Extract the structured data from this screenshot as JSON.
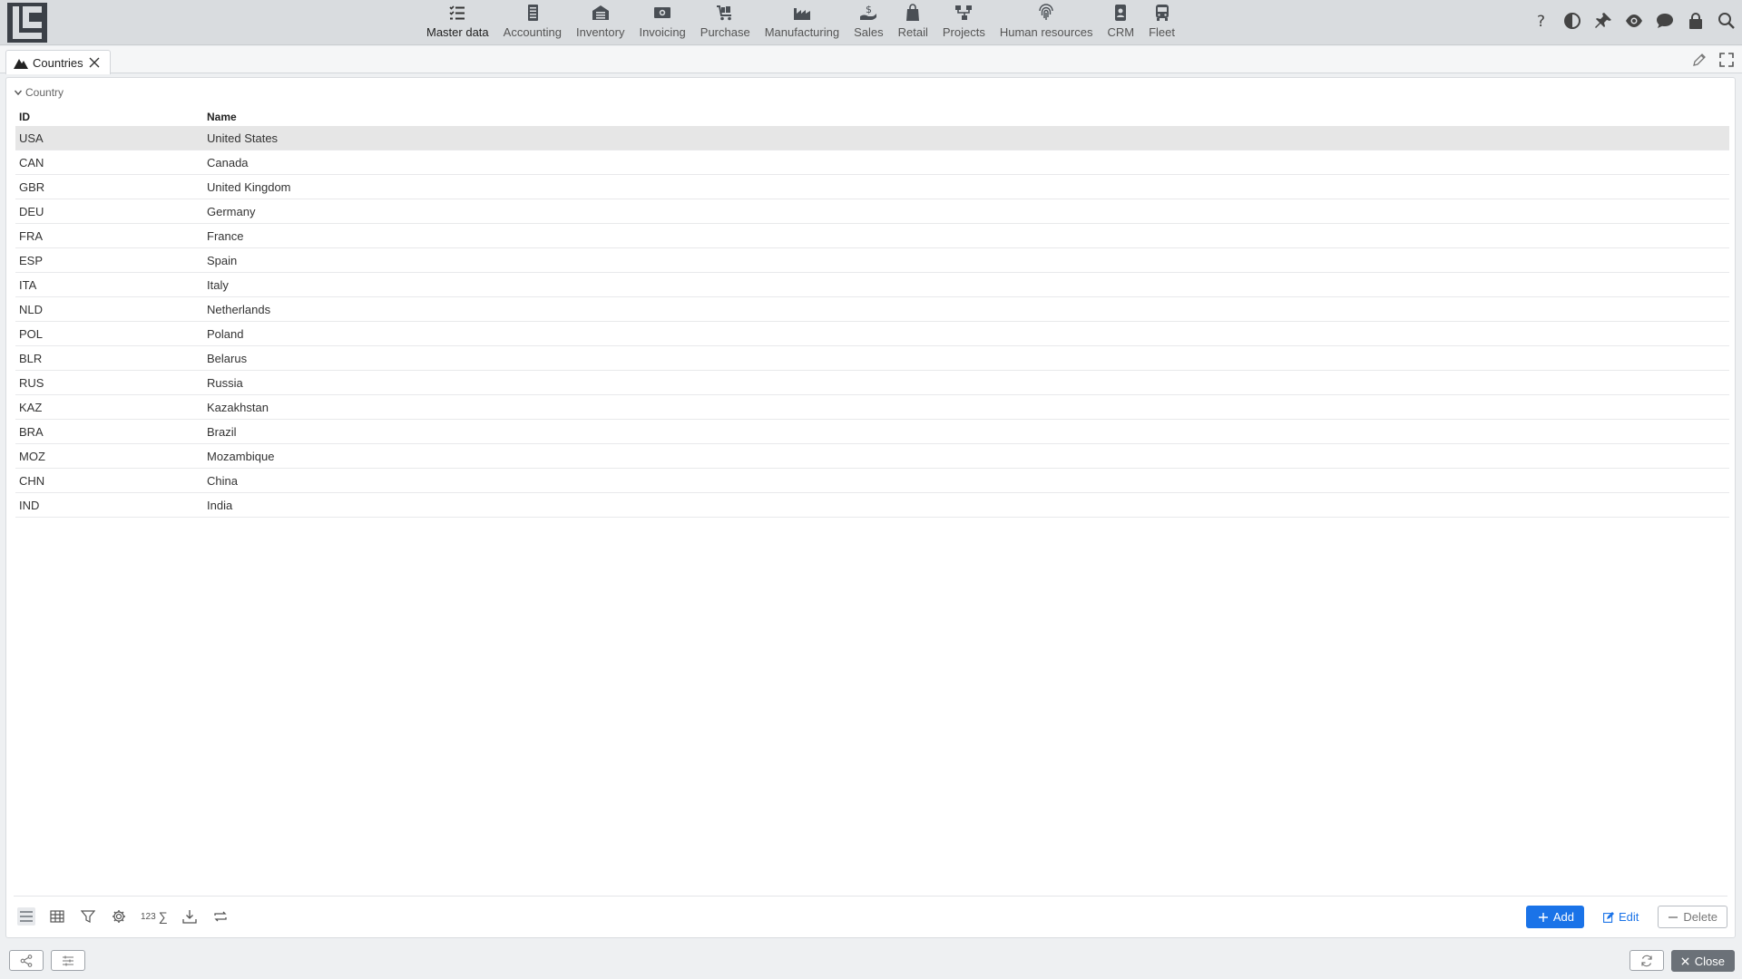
{
  "app": {
    "logo_icon": "app-logo",
    "nav": [
      {
        "label": "Master data",
        "icon": "checklist-icon",
        "active": true
      },
      {
        "label": "Accounting",
        "icon": "ledger-icon"
      },
      {
        "label": "Inventory",
        "icon": "warehouse-icon"
      },
      {
        "label": "Invoicing",
        "icon": "banknote-icon"
      },
      {
        "label": "Purchase",
        "icon": "cart-icon"
      },
      {
        "label": "Manufacturing",
        "icon": "factory-icon"
      },
      {
        "label": "Sales",
        "icon": "hand-dollar-icon"
      },
      {
        "label": "Retail",
        "icon": "shopping-bag-icon"
      },
      {
        "label": "Projects",
        "icon": "hierarchy-icon"
      },
      {
        "label": "Human resources",
        "icon": "fingerprint-icon"
      },
      {
        "label": "CRM",
        "icon": "contact-card-icon"
      },
      {
        "label": "Fleet",
        "icon": "bus-icon"
      }
    ],
    "top_tools": [
      "help-icon",
      "contrast-icon",
      "pin-icon",
      "eye-icon",
      "chat-icon",
      "lock-icon",
      "search-icon"
    ]
  },
  "tab": {
    "label": "Countries",
    "icon": "mountain-icon"
  },
  "panel": {
    "section_title": "Country",
    "columns": {
      "id": "ID",
      "name": "Name"
    },
    "rows": [
      {
        "id": "USA",
        "name": "United States",
        "selected": true
      },
      {
        "id": "CAN",
        "name": "Canada"
      },
      {
        "id": "GBR",
        "name": "United Kingdom"
      },
      {
        "id": "DEU",
        "name": "Germany"
      },
      {
        "id": "FRA",
        "name": "France"
      },
      {
        "id": "ESP",
        "name": "Spain"
      },
      {
        "id": "ITA",
        "name": "Italy"
      },
      {
        "id": "NLD",
        "name": "Netherlands"
      },
      {
        "id": "POL",
        "name": "Poland"
      },
      {
        "id": "BLR",
        "name": "Belarus"
      },
      {
        "id": "RUS",
        "name": "Russia"
      },
      {
        "id": "KAZ",
        "name": "Kazakhstan"
      },
      {
        "id": "BRA",
        "name": "Brazil"
      },
      {
        "id": "MOZ",
        "name": "Mozambique"
      },
      {
        "id": "CHN",
        "name": "China"
      },
      {
        "id": "IND",
        "name": "India"
      }
    ],
    "footer": {
      "sum_label": "123",
      "sum_symbol": "∑",
      "add_label": "Add",
      "edit_label": "Edit",
      "delete_label": "Delete"
    }
  },
  "statusbar": {
    "close_label": "Close"
  },
  "colors": {
    "accent": "#1a73e8",
    "topbar": "#d9dcdf",
    "selected_row": "#e6e6e6",
    "close_button": "#6b7178"
  }
}
